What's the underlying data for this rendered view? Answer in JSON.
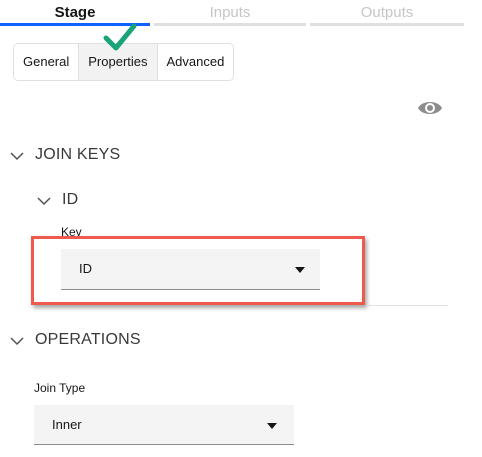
{
  "top_tabs": [
    {
      "label": "Stage",
      "active": true
    },
    {
      "label": "Inputs",
      "active": false
    },
    {
      "label": "Outputs",
      "active": false
    }
  ],
  "sub_tabs": [
    {
      "label": "General",
      "selected": false
    },
    {
      "label": "Properties",
      "selected": true
    },
    {
      "label": "Advanced",
      "selected": false
    }
  ],
  "sections": {
    "join_keys": {
      "title": "JOIN KEYS",
      "group_title": "ID",
      "key_label": "Key",
      "key_value": "ID"
    },
    "operations": {
      "title": "OPERATIONS",
      "join_type_label": "Join Type",
      "join_type_value": "Inner"
    }
  },
  "icons": {
    "check": "checkmark-icon",
    "eye": "eye-icon",
    "chevron": "chevron-down-icon",
    "caret": "caret-down-icon"
  },
  "colors": {
    "accent": "#0f62fe",
    "check": "#1aa37a",
    "highlight": "#ef5a4e",
    "field_bg": "#f4f4f4"
  }
}
